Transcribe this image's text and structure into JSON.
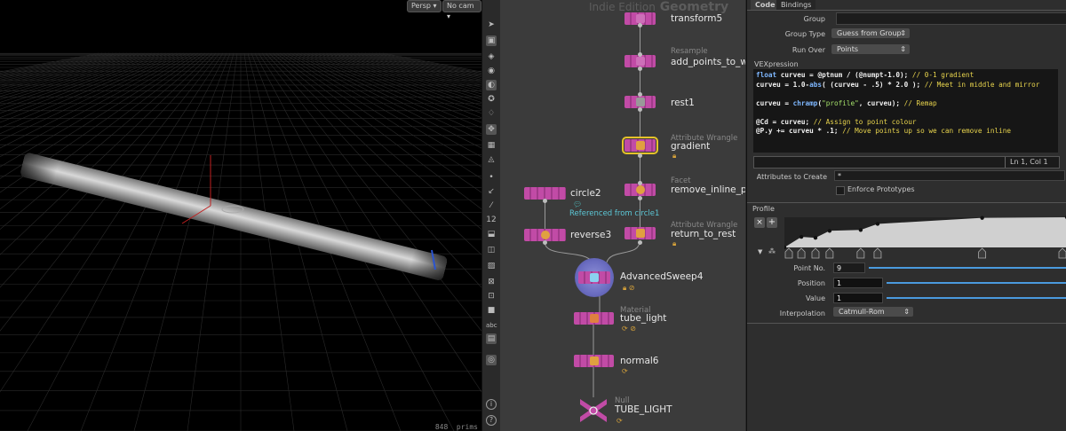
{
  "viewport": {
    "camera_mode": "Persp",
    "camera_select": "No cam",
    "prim_count": "848",
    "prim_unit": "prims"
  },
  "toolbar": {
    "icons": [
      "select-arrow-icon",
      "handle-icon",
      "view-icon",
      "camera-icon",
      "light-icon",
      "lamp-icon",
      "ghost-icon",
      "snap-icon",
      "snap-grid-icon",
      "snap-prim-icon",
      "point-icon",
      "normal-icon",
      "wand-icon",
      "number-icon",
      "paint-icon",
      "box-icon",
      "grid-icon",
      "group-icon",
      "square-icon",
      "text-icon",
      "image-icon",
      "vis-icon",
      "info-icon",
      "help-icon"
    ],
    "abc_label": "abc",
    "numbers_label": "12",
    "info_glyph": "i",
    "help_glyph": "?"
  },
  "network": {
    "watermark_edition": "Indie Edition",
    "watermark_context": "Geometry",
    "nodes": [
      {
        "name": "transform5",
        "type": ""
      },
      {
        "name": "add_points_to_wo",
        "type": "Resample"
      },
      {
        "name": "rest1",
        "type": ""
      },
      {
        "name": "gradient",
        "type": "Attribute Wrangle"
      },
      {
        "name": "remove_inline_po",
        "type": "Facet"
      },
      {
        "name": "circle2",
        "type": ""
      },
      {
        "name": "reverse3",
        "type": ""
      },
      {
        "name": "return_to_rest",
        "type": "Attribute Wrangle"
      },
      {
        "name": "AdvancedSweep4",
        "type": ""
      },
      {
        "name": "tube_light",
        "type": "Material"
      },
      {
        "name": "normal6",
        "type": ""
      },
      {
        "name": "TUBE_LIGHT",
        "type": "Null"
      }
    ],
    "reference_note": "Referenced from circle1"
  },
  "params": {
    "tabs": [
      "Code",
      "Bindings"
    ],
    "group_label": "Group",
    "group_value": "",
    "group_type_label": "Group Type",
    "group_type_value": "Guess from Group",
    "run_over_label": "Run Over",
    "run_over_value": "Points",
    "vexpression_label": "VEXpression",
    "code_lines": [
      [
        [
          "kw",
          "float"
        ],
        [
          "cx",
          " curveu = @ptnum / (@numpt-1.0); "
        ],
        [
          "cm",
          "// 0-1 gradient"
        ]
      ],
      [
        [
          "cx",
          "curveu = 1.0-"
        ],
        [
          "kw",
          "abs"
        ],
        [
          "cx",
          "( (curveu - .5) * 2.0 ); "
        ],
        [
          "cm",
          "// Meet in middle and mirror"
        ]
      ],
      [
        [
          "cx",
          ""
        ]
      ],
      [
        [
          "cx",
          "curveu = "
        ],
        [
          "kw",
          "chramp"
        ],
        [
          "cx",
          "("
        ],
        [
          "st",
          "\"profile\""
        ],
        [
          "cx",
          ", curveu); "
        ],
        [
          "cm",
          "// Remap"
        ]
      ],
      [
        [
          "cx",
          ""
        ]
      ],
      [
        [
          "cx",
          "@Cd = curveu; "
        ],
        [
          "cm",
          "// Assign to point colour"
        ]
      ],
      [
        [
          "cx",
          "@P.y += curveu * .1; "
        ],
        [
          "cm",
          "// Move points up so we can remove inline"
        ]
      ]
    ],
    "cursor_pos": "Ln 1, Col 1",
    "attributes_label": "Attributes to Create",
    "attributes_value": "*",
    "enforce_label": "Enforce Prototypes",
    "profile_label": "Profile",
    "point_no_label": "Point No.",
    "point_no_value": "9",
    "position_label": "Position",
    "position_value": "1",
    "value_label": "Value",
    "value_value": "1",
    "interpolation_label": "Interpolation",
    "interpolation_value": "Catmull-Rom",
    "ramp_points": [
      {
        "pos": 0.0,
        "val": 0.0
      },
      {
        "pos": 0.06,
        "val": 0.35
      },
      {
        "pos": 0.11,
        "val": 0.32
      },
      {
        "pos": 0.16,
        "val": 0.55
      },
      {
        "pos": 0.27,
        "val": 0.58
      },
      {
        "pos": 0.33,
        "val": 0.78
      },
      {
        "pos": 0.7,
        "val": 0.98
      },
      {
        "pos": 1.0,
        "val": 1.0
      }
    ]
  },
  "colors": {
    "node": "#c14ba6",
    "accent": "#4a9ade",
    "selected_outline": "#e6c229"
  }
}
